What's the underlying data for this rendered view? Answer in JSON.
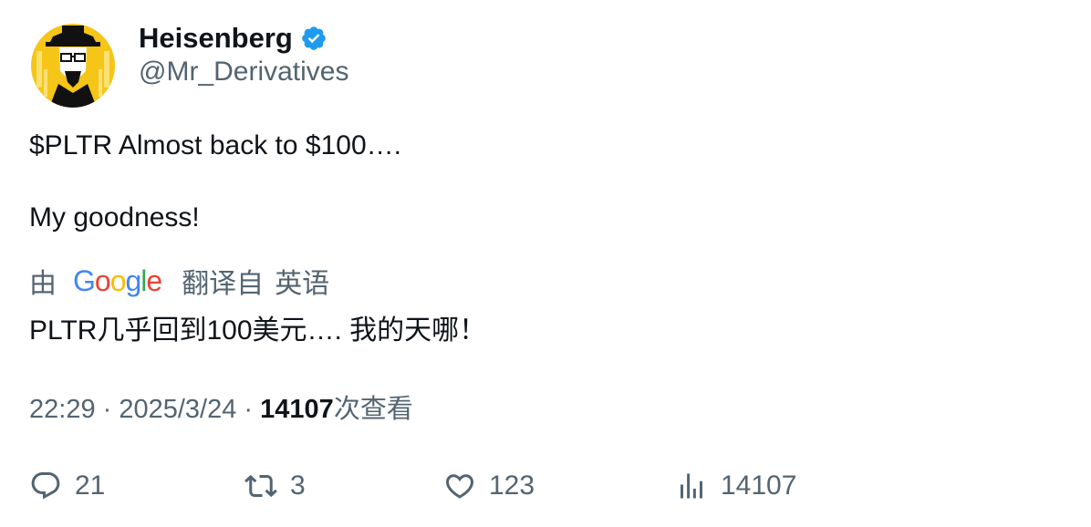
{
  "author": {
    "display_name": "Heisenberg",
    "handle": "@Mr_Derivatives",
    "verified": true,
    "avatar_icon": "heisenberg-avatar",
    "colors": {
      "verified_badge": "#1d9bf0",
      "avatar_bg": "#f5c518"
    }
  },
  "tweet": {
    "line1": "$PLTR Almost back to $100….",
    "line2": "My goodness!"
  },
  "translation": {
    "by_label": "由",
    "provider": [
      "G",
      "o",
      "o",
      "g",
      "l",
      "e"
    ],
    "provider_colors": [
      "#4285f4",
      "#ea4335",
      "#fbbc05",
      "#4285f4",
      "#34a853",
      "#ea4335"
    ],
    "from_label": "翻译自",
    "language": "英语",
    "text": "PLTR几乎回到100美元…. 我的天哪！"
  },
  "meta": {
    "time": "22:29",
    "sep1": " · ",
    "date": "2025/3/24",
    "sep2": " · ",
    "views_count": "14107",
    "views_label": "次查看"
  },
  "actions": {
    "reply": {
      "icon": "reply-icon",
      "count": "21"
    },
    "retweet": {
      "icon": "retweet-icon",
      "count": "3"
    },
    "like": {
      "icon": "heart-icon",
      "count": "123"
    },
    "views": {
      "icon": "views-icon",
      "count": "14107"
    }
  }
}
